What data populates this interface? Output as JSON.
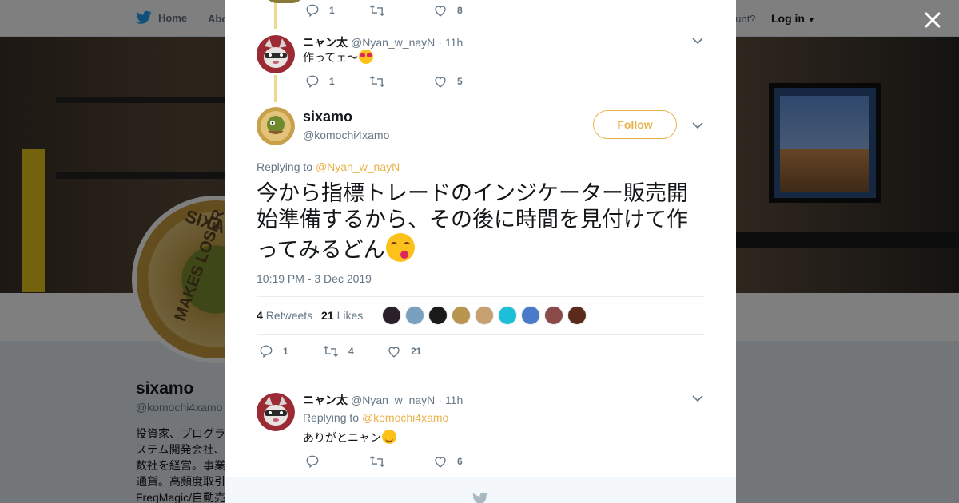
{
  "background": {
    "nav": {
      "home_label": "Home",
      "about_label": "Abo",
      "account_text": "ccount?",
      "login_label": "Log in"
    },
    "profile": {
      "name": "sixamo",
      "handle": "@komochi4xamo",
      "bio_lines": [
        "投資家、プログラ",
        "ステム開発会社、",
        "数社を経営。事業",
        "通貨。高頻度取引",
        "FreqMagic/自動売"
      ],
      "avatar_ring_text_1": "SIXA",
      "avatar_ring_text_2": "MAKES LOSER"
    }
  },
  "modal": {
    "tweet_above": {
      "reply_count": "1",
      "like_count": "8"
    },
    "reply1": {
      "name": "ニャン太",
      "handle": "@Nyan_w_nayN",
      "separator": "·",
      "time": "11h",
      "text": "作ってェ〜",
      "reply_count": "1",
      "like_count": "5"
    },
    "main": {
      "name": "sixamo",
      "handle": "@komochi4xamo",
      "follow_label": "Follow",
      "replying_prefix": "Replying to",
      "replying_to": "@Nyan_w_nayN",
      "text": "今から指標トレードのインジケーター販売開始準備するから、その後に時間を見付けて作ってみるどん",
      "timestamp": "10:19 PM - 3 Dec 2019",
      "retweets_count": "4",
      "retweets_label": "Retweets",
      "likes_count": "21",
      "likes_label": "Likes",
      "liker_colors": [
        "#2b1f2a",
        "#7aa0c0",
        "#1a1a1a",
        "#b99550",
        "#c8a070",
        "#1dbfd8",
        "#4a7ac8",
        "#8a4a4a",
        "#5a2a1a"
      ],
      "reply_count": "1",
      "retweet_count_action": "4",
      "like_count_action": "21"
    },
    "reply2": {
      "name": "ニャン太",
      "handle": "@Nyan_w_nayN",
      "separator": "·",
      "time": "11h",
      "replying_prefix": "Replying to",
      "replying_to": "@komochi4xamo",
      "text": "ありがとニャン",
      "like_count": "6"
    },
    "colors": {
      "accent": "#e8b34b",
      "thread_line": "#f2d88a",
      "muted": "#657786"
    }
  }
}
